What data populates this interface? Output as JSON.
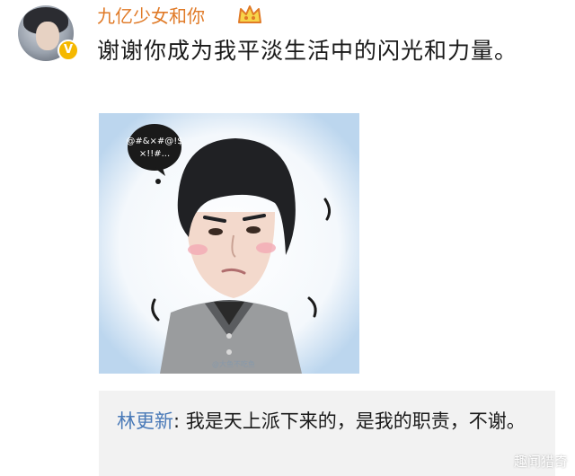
{
  "post": {
    "author": "九亿少女和你",
    "text": "谢谢你成为我平淡生活中的闪光和力量。",
    "image": {
      "speech_bubble_text": "@#&×#@!$\n×!!#...",
      "watermark_text": "@大鱼不吃鱼"
    }
  },
  "reply": {
    "author": "林更新",
    "separator": ": ",
    "text": "我是天上派下来的，是我的职责，不谢。"
  },
  "watermark": "趣闻猎奇",
  "colors": {
    "username": "#e07a27",
    "reply_author": "#4a7ab8",
    "reply_bg": "#f2f2f2",
    "verified_badge": "#f5b800"
  },
  "icons": [
    "verified-badge-icon",
    "crown-icon"
  ]
}
